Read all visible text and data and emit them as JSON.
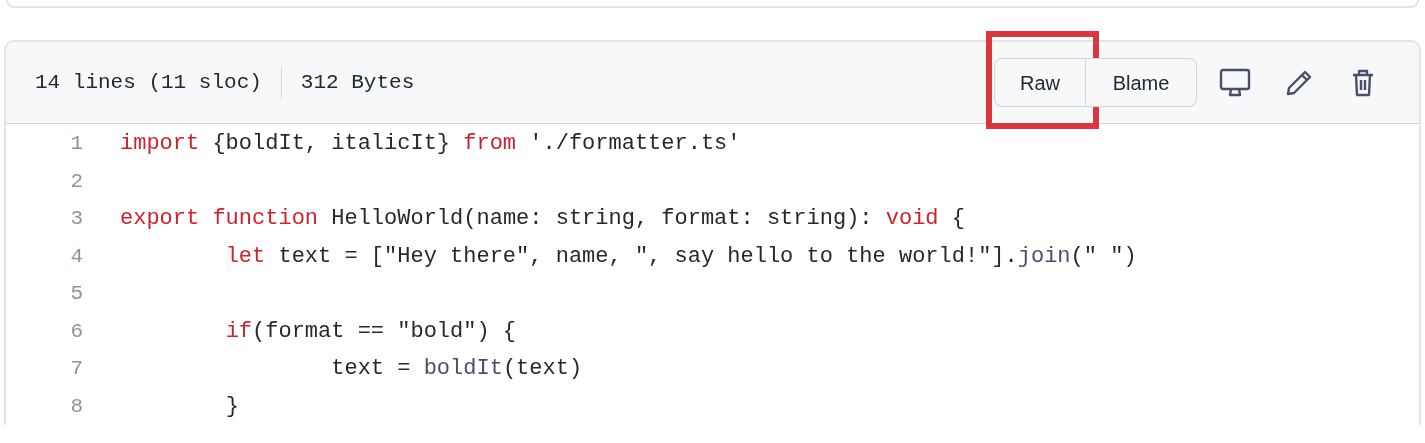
{
  "file_info": {
    "lines": "14 lines (11 sloc)",
    "size": "312 Bytes"
  },
  "buttons": [
    {
      "label": "Raw",
      "highlighted": true
    },
    {
      "label": "Blame",
      "highlighted": false
    }
  ],
  "code_lines": [
    {
      "number": "1",
      "tokens": [
        {
          "kind": "keyword",
          "text": "import"
        },
        {
          "kind": "plain",
          "text": " {boldIt, italicIt} "
        },
        {
          "kind": "keyword",
          "text": "from"
        },
        {
          "kind": "plain",
          "text": " './formatter.ts'"
        }
      ]
    },
    {
      "number": "2"
    },
    {
      "number": "3",
      "tokens": [
        {
          "kind": "keyword",
          "text": "export function"
        },
        {
          "kind": "plain",
          "text": " HelloWorld(name: string, format: string): "
        },
        {
          "kind": "keyword",
          "text": "void"
        },
        {
          "kind": "plain",
          "text": " {"
        }
      ]
    },
    {
      "number": "4",
      "tokens": [
        {
          "kind": "keyword",
          "text": "\tlet"
        },
        {
          "kind": "plain",
          "text": " text = [\"Hey there\", name, \", say hello to the world!\"]."
        },
        {
          "kind": "call",
          "text": "join"
        },
        {
          "kind": "plain",
          "text": "(\" \")"
        }
      ]
    },
    {
      "number": "5"
    },
    {
      "number": "6",
      "tokens": [
        {
          "kind": "keyword",
          "text": "\tif"
        },
        {
          "kind": "plain",
          "text": "(format == \"bold\") {"
        }
      ]
    },
    {
      "number": "7",
      "tokens": [
        {
          "kind": "plain",
          "text": "\t\ttext = "
        },
        {
          "kind": "call",
          "text": "boldIt"
        },
        {
          "kind": "plain",
          "text": "(text)"
        }
      ]
    },
    {
      "number": "8",
      "tokens": [
        {
          "kind": "plain",
          "text": "\t}"
        }
      ]
    }
  ]
}
